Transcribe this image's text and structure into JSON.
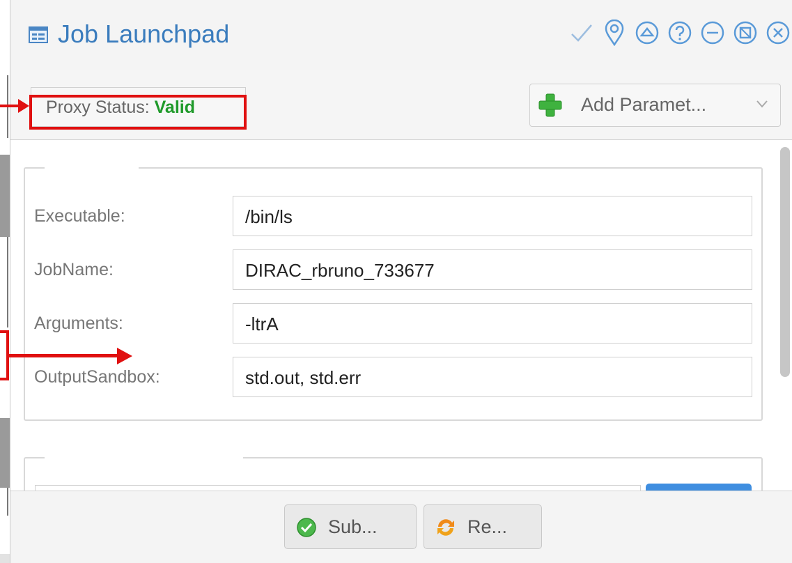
{
  "window": {
    "title": "Job Launchpad",
    "tools": [
      {
        "name": "check-icon"
      },
      {
        "name": "pin-icon"
      },
      {
        "name": "collapse-icon"
      },
      {
        "name": "help-icon"
      },
      {
        "name": "minimize-icon"
      },
      {
        "name": "restore-icon"
      },
      {
        "name": "close-icon"
      }
    ]
  },
  "toolbar": {
    "proxy_label": "Proxy Status:",
    "proxy_value": "Valid",
    "add_parameter_label": "Add Paramet..."
  },
  "form": {
    "rows": [
      {
        "label": "Executable:",
        "value": "/bin/ls"
      },
      {
        "label": "JobName:",
        "value": "DIRAC_rbruno_733677"
      },
      {
        "label": "Arguments:",
        "value": "-ltrA"
      },
      {
        "label": "OutputSandbox:",
        "value": "std.out, std.err"
      }
    ]
  },
  "footer": {
    "submit_label": "Sub...",
    "reset_label": "Re..."
  },
  "colors": {
    "accent": "#3a7cbd",
    "valid": "#1f9a2a",
    "annotation": "#e01010"
  }
}
